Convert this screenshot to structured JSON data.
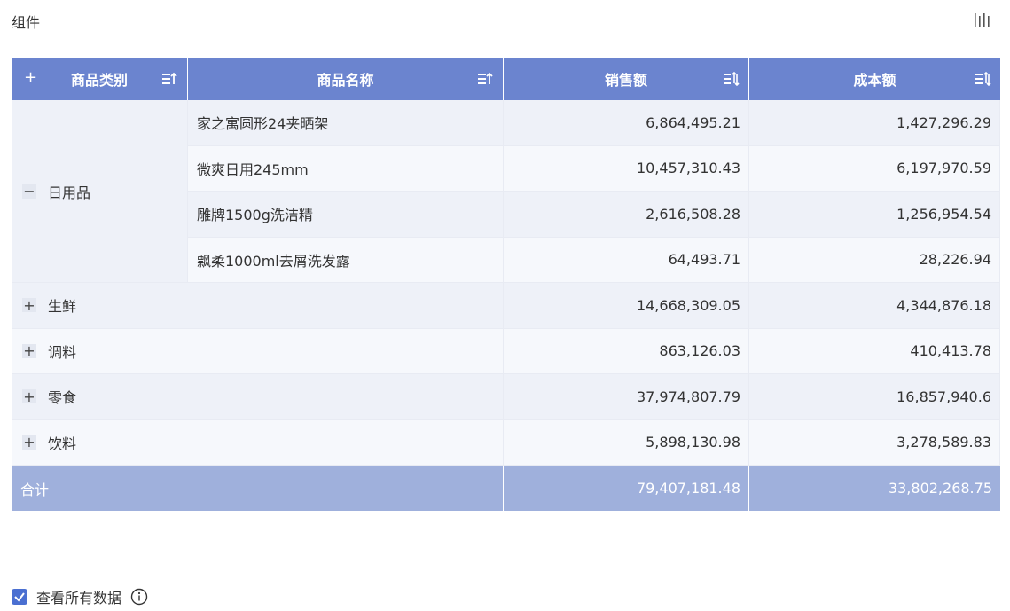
{
  "component": {
    "title": "组件"
  },
  "table": {
    "headers": {
      "category": "商品类别",
      "product": "商品名称",
      "sales": "销售额",
      "cost": "成本额"
    },
    "expanded_group": {
      "toggle": "−",
      "name": "日用品",
      "rows": [
        {
          "product": "家之寓圆形24夹晒架",
          "sales": "6,864,495.21",
          "cost": "1,427,296.29"
        },
        {
          "product": "微爽日用245mm",
          "sales": "10,457,310.43",
          "cost": "6,197,970.59"
        },
        {
          "product": "雕牌1500g洗洁精",
          "sales": "2,616,508.28",
          "cost": "1,256,954.54"
        },
        {
          "product": "飘柔1000ml去屑洗发露",
          "sales": "64,493.71",
          "cost": "28,226.94"
        }
      ]
    },
    "collapsed_groups": [
      {
        "toggle": "+",
        "name": "生鲜",
        "sales": "14,668,309.05",
        "cost": "4,344,876.18"
      },
      {
        "toggle": "+",
        "name": "调料",
        "sales": "863,126.03",
        "cost": "410,413.78"
      },
      {
        "toggle": "+",
        "name": "零食",
        "sales": "37,974,807.79",
        "cost": "16,857,940.6"
      },
      {
        "toggle": "+",
        "name": "饮料",
        "sales": "5,898,130.98",
        "cost": "3,278,589.83"
      }
    ],
    "total": {
      "label": "合计",
      "sales": "79,407,181.48",
      "cost": "33,802,268.75"
    }
  },
  "footer": {
    "view_all_label": "查看所有数据",
    "checked": true
  },
  "colors": {
    "header": "#6b84cf",
    "total": "#9fb0dc",
    "checkbox": "#4a6fd1"
  }
}
